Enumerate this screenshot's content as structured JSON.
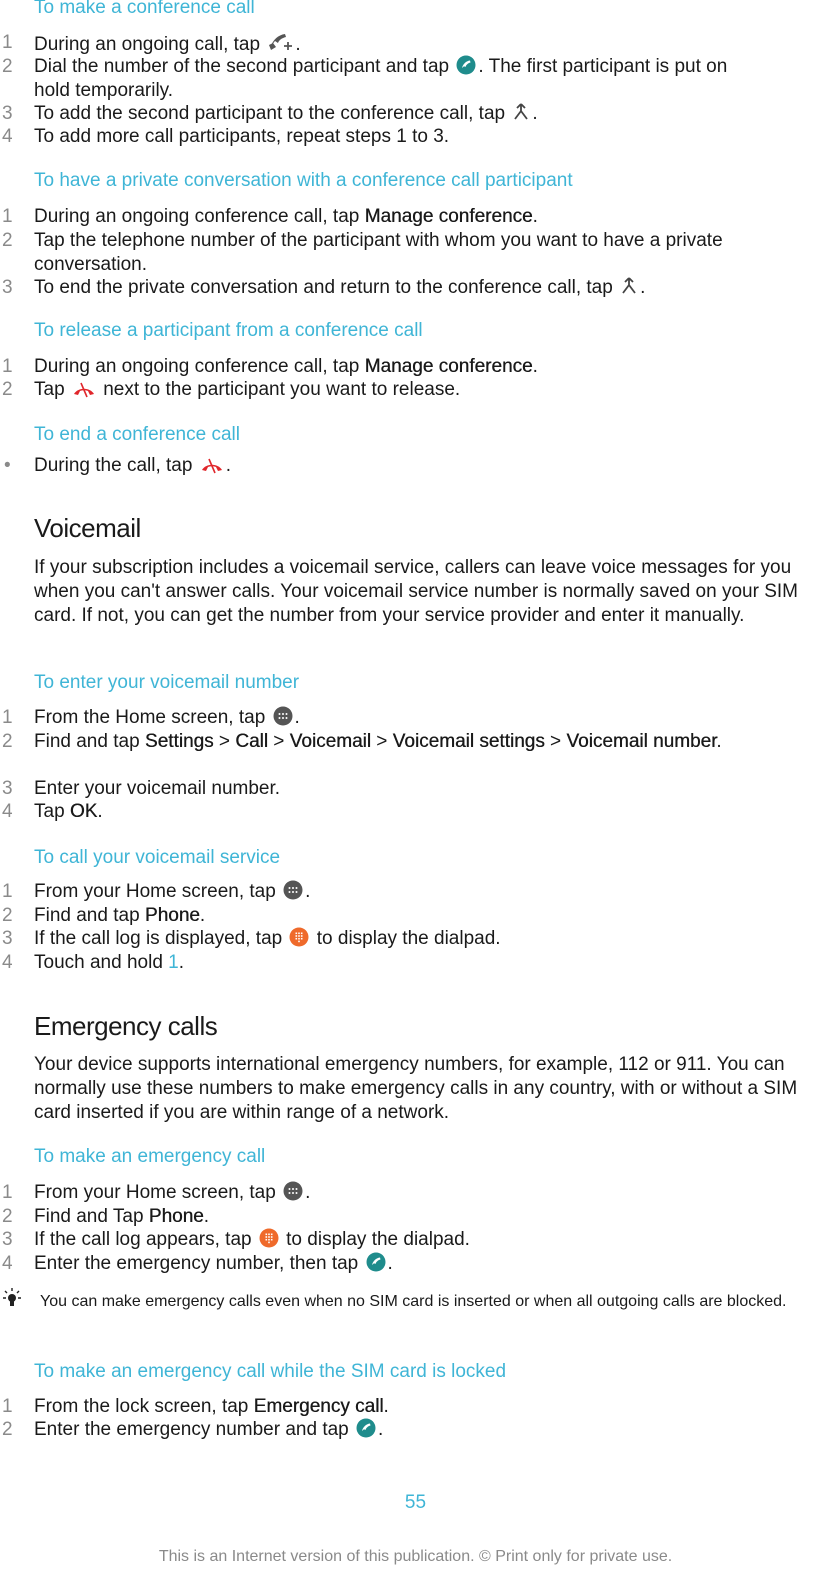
{
  "sections": {
    "conference_add": {
      "title": "To make a conference call",
      "steps": [
        {
          "num": "1",
          "pre": "During an ongoing call, tap",
          "post": "."
        },
        {
          "num": "2",
          "pre": "Dial the number of the second participant and tap",
          "post": ". The first participant is put on hold temporarily."
        },
        {
          "num": "3",
          "pre": "To add the second participant to the conference call, tap",
          "post": "."
        },
        {
          "num": "4",
          "text": "To add more call participants, repeat steps 1 to 3."
        }
      ]
    },
    "conference_private": {
      "title": "To have a private conversation with a conference call participant",
      "steps": [
        {
          "num": "1",
          "pre": "During an ongoing conference call, tap",
          "bold": "Manage conference",
          "post": "."
        },
        {
          "num": "2",
          "text": "Tap the telephone number of the participant with whom you want to have a private conversation."
        },
        {
          "num": "3",
          "pre": "To end the private conversation and return to the conference call, tap",
          "post": "."
        }
      ]
    },
    "conference_release": {
      "title": "To release a participant from a conference call",
      "steps": [
        {
          "num": "1",
          "pre": "During an ongoing conference call, tap",
          "bold": "Manage conference",
          "post": "."
        },
        {
          "num": "2",
          "pre": "Tap",
          "post": "next to the participant you want to release."
        }
      ]
    },
    "conference_end": {
      "title": "To end a conference call",
      "steps": [
        {
          "num": "•",
          "pre": "During the call, tap",
          "post": "."
        }
      ]
    },
    "voicemail": {
      "heading": "Voicemail",
      "body": "If your subscription includes a voicemail service, callers can leave voice messages for you when you can't answer calls. Your voicemail service number is normally saved on your SIM card. If not, you can get the number from your service provider and enter it manually."
    },
    "voicemail_enter": {
      "title": "To enter your voicemail number",
      "steps": [
        {
          "num": "1",
          "pre": "From the Home screen, tap",
          "post": "."
        },
        {
          "num": "2",
          "pre": "Find and tap",
          "path": [
            "Settings",
            "Call",
            "Voicemail",
            "Voicemail settings",
            "Voicemail number"
          ],
          "sep": ">",
          "post": "."
        },
        {
          "num": "3",
          "text": "Enter your voicemail number."
        },
        {
          "num": "4",
          "pre": "Tap",
          "bold": "OK",
          "post": "."
        }
      ]
    },
    "voicemail_call": {
      "title": "To call your voicemail service",
      "steps": [
        {
          "num": "1",
          "pre": "From your Home screen, tap",
          "post": "."
        },
        {
          "num": "2",
          "pre": "Find and tap",
          "bold": "Phone",
          "post": "."
        },
        {
          "num": "3",
          "pre": "If the call log is displayed, tap",
          "post": "to display the dialpad."
        },
        {
          "num": "4",
          "pre": "Touch and hold",
          "blue": "1",
          "post": "."
        }
      ]
    },
    "emergency": {
      "heading": "Emergency calls",
      "body": "Your device supports international emergency numbers, for example, 112 or 911. You can normally use these numbers to make emergency calls in any country, with or without a SIM card inserted if you are within range of a network."
    },
    "emergency_make": {
      "title": "To make an emergency call",
      "steps": [
        {
          "num": "1",
          "pre": "From your Home screen, tap",
          "post": "."
        },
        {
          "num": "2",
          "pre": "Find and Tap",
          "bold": "Phone",
          "post": "."
        },
        {
          "num": "3",
          "pre": "If the call log appears, tap",
          "post": "to display the dialpad."
        },
        {
          "num": "4",
          "pre": "Enter the emergency number, then tap",
          "post": "."
        }
      ],
      "tip": "You can make emergency calls even when no SIM card is inserted or when all outgoing calls are blocked."
    },
    "emergency_locked": {
      "title": "To make an emergency call while the SIM card is locked",
      "steps": [
        {
          "num": "1",
          "pre": "From the lock screen, tap",
          "bold": "Emergency call",
          "post": "."
        },
        {
          "num": "2",
          "pre": "Enter the emergency number and tap",
          "post": "."
        }
      ]
    }
  },
  "icons": {
    "add_call": "add-call-icon",
    "call_button": "call-icon",
    "merge": "merge-calls-icon",
    "end_call": "end-call-icon",
    "apps": "app-screen-icon",
    "dialpad": "dialpad-icon",
    "tip": "lightbulb-icon"
  },
  "colors": {
    "accent": "#3fb5d6",
    "call_green": "#1f8c8c",
    "end_red": "#e0262b",
    "dialpad_orange": "#ef6a2b",
    "apps_gray": "#555555"
  },
  "footer": {
    "page_number": "55",
    "notice": "This is an Internet version of this publication. © Print only for private use."
  }
}
